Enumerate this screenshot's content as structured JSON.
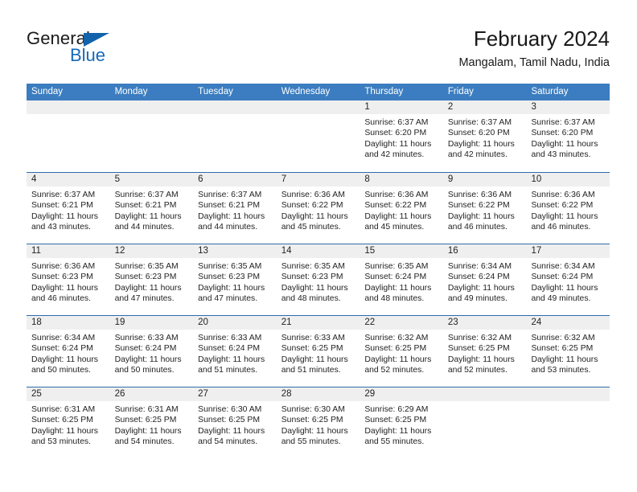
{
  "logo": {
    "word1": "General",
    "word2": "Blue",
    "triangle_color": "#1262ac",
    "blue_color": "#1569b9"
  },
  "header": {
    "title": "February 2024",
    "subtitle": "Mangalam, Tamil Nadu, India",
    "accent_color": "#3b7dc0"
  },
  "calendar": {
    "weekday_headers": [
      "Sunday",
      "Monday",
      "Tuesday",
      "Wednesday",
      "Thursday",
      "Friday",
      "Saturday"
    ],
    "header_bg": "#3b7dc0",
    "daynum_band_bg": "#efefef",
    "row_rule_color": "#2c6cad",
    "weeks": [
      [
        {
          "day": "",
          "lines": []
        },
        {
          "day": "",
          "lines": []
        },
        {
          "day": "",
          "lines": []
        },
        {
          "day": "",
          "lines": []
        },
        {
          "day": "1",
          "lines": [
            "Sunrise: 6:37 AM",
            "Sunset: 6:20 PM",
            "Daylight: 11 hours",
            "and 42 minutes."
          ]
        },
        {
          "day": "2",
          "lines": [
            "Sunrise: 6:37 AM",
            "Sunset: 6:20 PM",
            "Daylight: 11 hours",
            "and 42 minutes."
          ]
        },
        {
          "day": "3",
          "lines": [
            "Sunrise: 6:37 AM",
            "Sunset: 6:20 PM",
            "Daylight: 11 hours",
            "and 43 minutes."
          ]
        }
      ],
      [
        {
          "day": "4",
          "lines": [
            "Sunrise: 6:37 AM",
            "Sunset: 6:21 PM",
            "Daylight: 11 hours",
            "and 43 minutes."
          ]
        },
        {
          "day": "5",
          "lines": [
            "Sunrise: 6:37 AM",
            "Sunset: 6:21 PM",
            "Daylight: 11 hours",
            "and 44 minutes."
          ]
        },
        {
          "day": "6",
          "lines": [
            "Sunrise: 6:37 AM",
            "Sunset: 6:21 PM",
            "Daylight: 11 hours",
            "and 44 minutes."
          ]
        },
        {
          "day": "7",
          "lines": [
            "Sunrise: 6:36 AM",
            "Sunset: 6:22 PM",
            "Daylight: 11 hours",
            "and 45 minutes."
          ]
        },
        {
          "day": "8",
          "lines": [
            "Sunrise: 6:36 AM",
            "Sunset: 6:22 PM",
            "Daylight: 11 hours",
            "and 45 minutes."
          ]
        },
        {
          "day": "9",
          "lines": [
            "Sunrise: 6:36 AM",
            "Sunset: 6:22 PM",
            "Daylight: 11 hours",
            "and 46 minutes."
          ]
        },
        {
          "day": "10",
          "lines": [
            "Sunrise: 6:36 AM",
            "Sunset: 6:22 PM",
            "Daylight: 11 hours",
            "and 46 minutes."
          ]
        }
      ],
      [
        {
          "day": "11",
          "lines": [
            "Sunrise: 6:36 AM",
            "Sunset: 6:23 PM",
            "Daylight: 11 hours",
            "and 46 minutes."
          ]
        },
        {
          "day": "12",
          "lines": [
            "Sunrise: 6:35 AM",
            "Sunset: 6:23 PM",
            "Daylight: 11 hours",
            "and 47 minutes."
          ]
        },
        {
          "day": "13",
          "lines": [
            "Sunrise: 6:35 AM",
            "Sunset: 6:23 PM",
            "Daylight: 11 hours",
            "and 47 minutes."
          ]
        },
        {
          "day": "14",
          "lines": [
            "Sunrise: 6:35 AM",
            "Sunset: 6:23 PM",
            "Daylight: 11 hours",
            "and 48 minutes."
          ]
        },
        {
          "day": "15",
          "lines": [
            "Sunrise: 6:35 AM",
            "Sunset: 6:24 PM",
            "Daylight: 11 hours",
            "and 48 minutes."
          ]
        },
        {
          "day": "16",
          "lines": [
            "Sunrise: 6:34 AM",
            "Sunset: 6:24 PM",
            "Daylight: 11 hours",
            "and 49 minutes."
          ]
        },
        {
          "day": "17",
          "lines": [
            "Sunrise: 6:34 AM",
            "Sunset: 6:24 PM",
            "Daylight: 11 hours",
            "and 49 minutes."
          ]
        }
      ],
      [
        {
          "day": "18",
          "lines": [
            "Sunrise: 6:34 AM",
            "Sunset: 6:24 PM",
            "Daylight: 11 hours",
            "and 50 minutes."
          ]
        },
        {
          "day": "19",
          "lines": [
            "Sunrise: 6:33 AM",
            "Sunset: 6:24 PM",
            "Daylight: 11 hours",
            "and 50 minutes."
          ]
        },
        {
          "day": "20",
          "lines": [
            "Sunrise: 6:33 AM",
            "Sunset: 6:24 PM",
            "Daylight: 11 hours",
            "and 51 minutes."
          ]
        },
        {
          "day": "21",
          "lines": [
            "Sunrise: 6:33 AM",
            "Sunset: 6:25 PM",
            "Daylight: 11 hours",
            "and 51 minutes."
          ]
        },
        {
          "day": "22",
          "lines": [
            "Sunrise: 6:32 AM",
            "Sunset: 6:25 PM",
            "Daylight: 11 hours",
            "and 52 minutes."
          ]
        },
        {
          "day": "23",
          "lines": [
            "Sunrise: 6:32 AM",
            "Sunset: 6:25 PM",
            "Daylight: 11 hours",
            "and 52 minutes."
          ]
        },
        {
          "day": "24",
          "lines": [
            "Sunrise: 6:32 AM",
            "Sunset: 6:25 PM",
            "Daylight: 11 hours",
            "and 53 minutes."
          ]
        }
      ],
      [
        {
          "day": "25",
          "lines": [
            "Sunrise: 6:31 AM",
            "Sunset: 6:25 PM",
            "Daylight: 11 hours",
            "and 53 minutes."
          ]
        },
        {
          "day": "26",
          "lines": [
            "Sunrise: 6:31 AM",
            "Sunset: 6:25 PM",
            "Daylight: 11 hours",
            "and 54 minutes."
          ]
        },
        {
          "day": "27",
          "lines": [
            "Sunrise: 6:30 AM",
            "Sunset: 6:25 PM",
            "Daylight: 11 hours",
            "and 54 minutes."
          ]
        },
        {
          "day": "28",
          "lines": [
            "Sunrise: 6:30 AM",
            "Sunset: 6:25 PM",
            "Daylight: 11 hours",
            "and 55 minutes."
          ]
        },
        {
          "day": "29",
          "lines": [
            "Sunrise: 6:29 AM",
            "Sunset: 6:25 PM",
            "Daylight: 11 hours",
            "and 55 minutes."
          ]
        },
        {
          "day": "",
          "lines": []
        },
        {
          "day": "",
          "lines": []
        }
      ]
    ]
  }
}
